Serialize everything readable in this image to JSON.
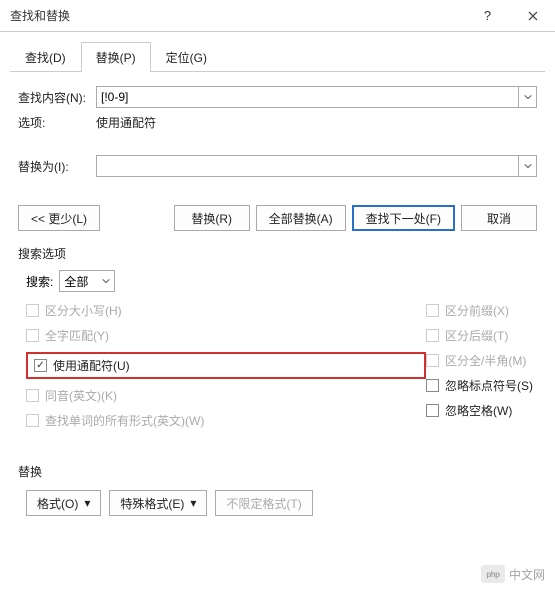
{
  "title": "查找和替换",
  "tabs": {
    "find": "查找(D)",
    "replace": "替换(P)",
    "goto": "定位(G)"
  },
  "find": {
    "label": "查找内容(N):",
    "value": "[!0-9]",
    "option_label": "选项:",
    "option_value": "使用通配符"
  },
  "replace": {
    "label": "替换为(I):",
    "value": ""
  },
  "buttons": {
    "less": "<<  更少(L)",
    "replace_one": "替换(R)",
    "replace_all": "全部替换(A)",
    "find_next": "查找下一处(F)",
    "cancel": "取消"
  },
  "search": {
    "section": "搜索选项",
    "label": "搜索:",
    "value": "全部"
  },
  "checks": {
    "left": [
      {
        "key": "case",
        "label": "区分大小写(H)",
        "checked": false,
        "disabled": true
      },
      {
        "key": "whole",
        "label": "全字匹配(Y)",
        "checked": false,
        "disabled": true
      },
      {
        "key": "wildcard",
        "label": "使用通配符(U)",
        "checked": true,
        "disabled": false,
        "highlight": true
      },
      {
        "key": "sounds",
        "label": "同音(英文)(K)",
        "checked": false,
        "disabled": true
      },
      {
        "key": "forms",
        "label": "查找单词的所有形式(英文)(W)",
        "checked": false,
        "disabled": true
      }
    ],
    "right": [
      {
        "key": "prefix",
        "label": "区分前缀(X)",
        "checked": false,
        "disabled": true
      },
      {
        "key": "suffix",
        "label": "区分后缀(T)",
        "checked": false,
        "disabled": true
      },
      {
        "key": "width",
        "label": "区分全/半角(M)",
        "checked": false,
        "disabled": true
      },
      {
        "key": "punct",
        "label": "忽略标点符号(S)",
        "checked": false,
        "disabled": false
      },
      {
        "key": "space",
        "label": "忽略空格(W)",
        "checked": false,
        "disabled": false
      }
    ]
  },
  "bottom": {
    "section": "替换",
    "format": "格式(O)",
    "special": "特殊格式(E)",
    "noformat": "不限定格式(T)"
  },
  "watermark": {
    "logo": "php",
    "text": "中文网"
  }
}
